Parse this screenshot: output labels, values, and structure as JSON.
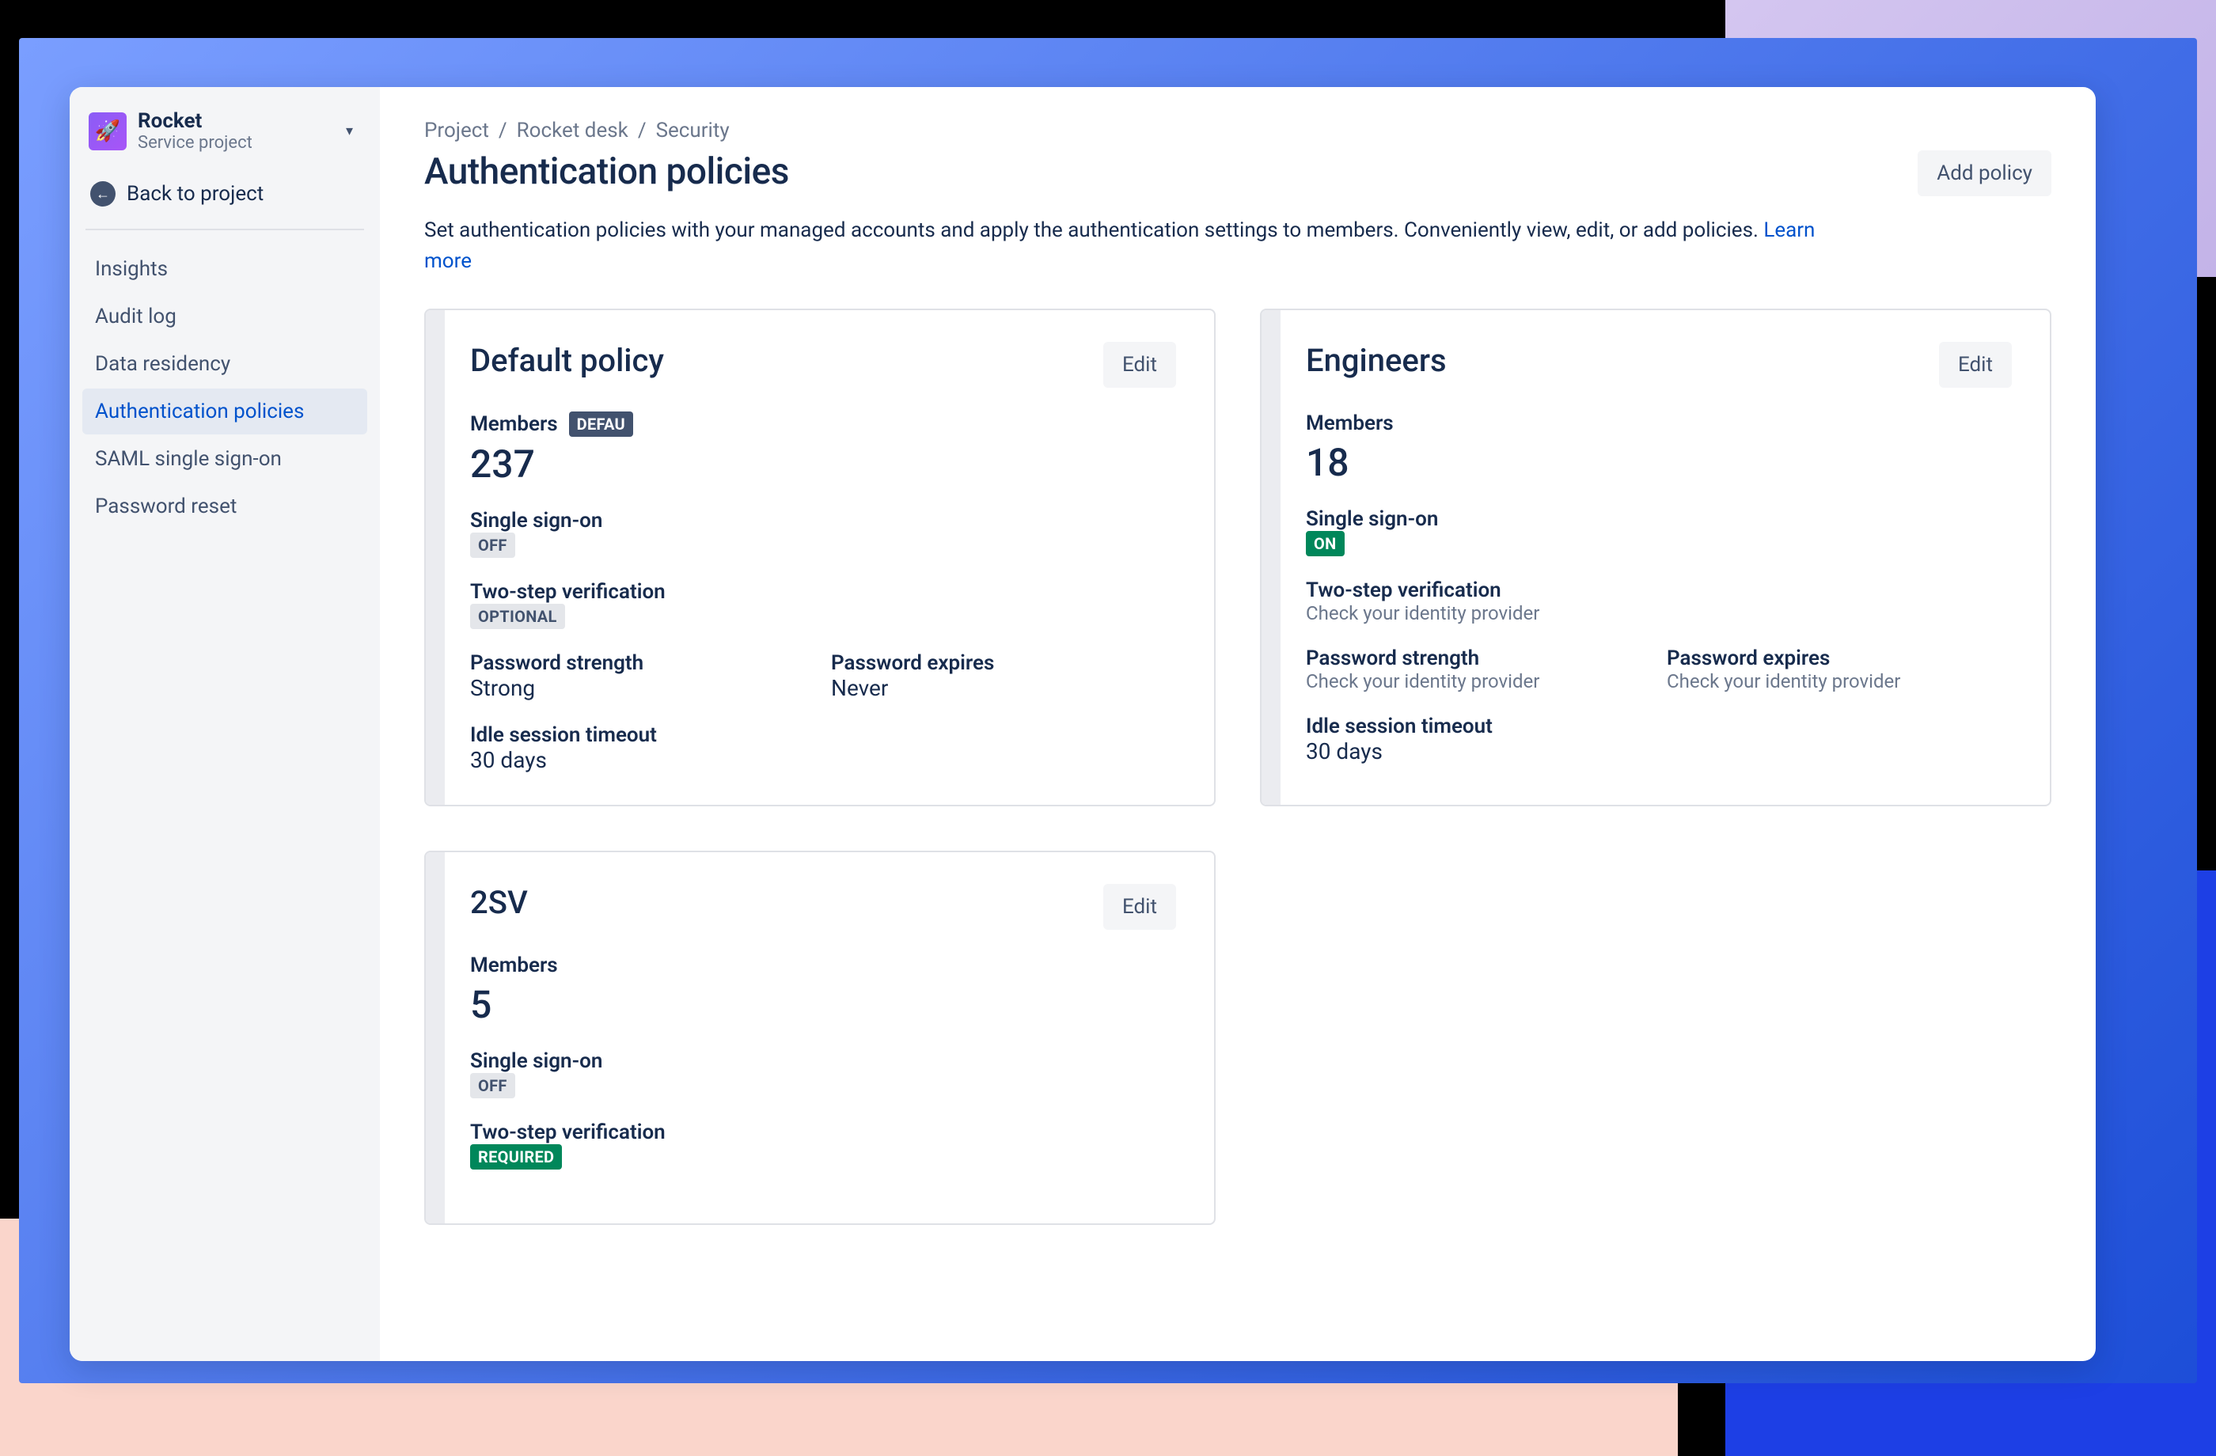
{
  "project": {
    "name": "Rocket",
    "sub": "Service project"
  },
  "back_link": "Back to project",
  "nav": [
    "Insights",
    "Audit log",
    "Data residency",
    "Authentication policies",
    "SAML single sign-on",
    "Password reset"
  ],
  "nav_active_index": 3,
  "breadcrumb": [
    "Project",
    "Rocket desk",
    "Security"
  ],
  "page_title": "Authentication policies",
  "add_policy_btn": "Add policy",
  "page_desc": "Set authentication policies with your managed accounts and apply the authentication settings to members. Conveniently view, edit, or add policies. ",
  "learn_more": "Learn more",
  "edit_label": "Edit",
  "labels": {
    "members": "Members",
    "sso": "Single sign-on",
    "two_step": "Two-step verification",
    "pw_strength": "Password strength",
    "pw_expires": "Password expires",
    "idle": "Idle session timeout",
    "idp_hint": "Check your identity provider"
  },
  "policies": [
    {
      "title": "Default policy",
      "members": "237",
      "default_badge": "DEFAU",
      "sso": {
        "type": "badge-gray",
        "text": "OFF"
      },
      "two_step": {
        "type": "badge-gray",
        "text": "OPTIONAL"
      },
      "pw_strength": "Strong",
      "pw_expires": "Never",
      "idle": "30 days",
      "idp": false
    },
    {
      "title": "Engineers",
      "members": "18",
      "default_badge": null,
      "sso": {
        "type": "badge-green",
        "text": "ON"
      },
      "two_step_hint": true,
      "pw_strength": null,
      "pw_expires": null,
      "idle": "30 days",
      "idp": true
    },
    {
      "title": "2SV",
      "members": "5",
      "default_badge": null,
      "sso": {
        "type": "badge-gray",
        "text": "OFF"
      },
      "two_step": {
        "type": "badge-green",
        "text": "REQUIRED"
      },
      "idp": false
    }
  ]
}
